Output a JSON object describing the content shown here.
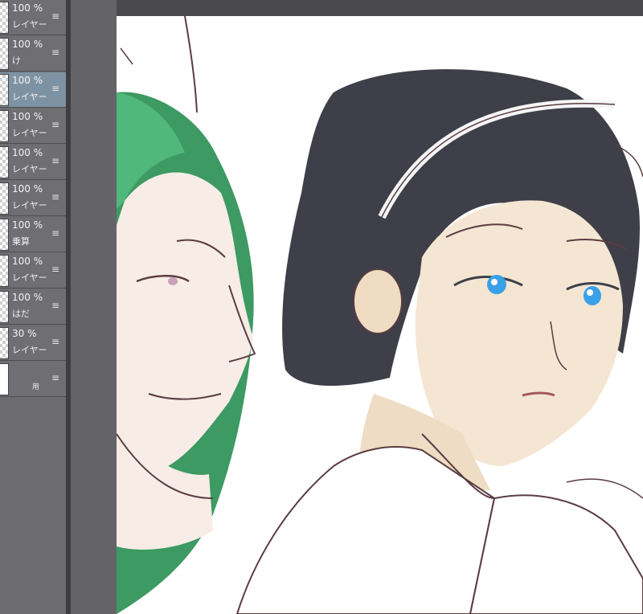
{
  "layers_panel": {
    "layers": [
      {
        "opacity": "100 %",
        "name": "レイヤー"
      },
      {
        "opacity": "100 %",
        "name": "け"
      },
      {
        "opacity": "100 %",
        "name": "レイヤー"
      },
      {
        "opacity": "100 %",
        "name": "レイヤー"
      },
      {
        "opacity": "100 %",
        "name": "レイヤー"
      },
      {
        "opacity": "100 %",
        "name": "レイヤー"
      },
      {
        "opacity": "100 %",
        "name": "乗算"
      },
      {
        "opacity": "100 %",
        "name": "レイヤー"
      },
      {
        "opacity": "100 %",
        "name": "はだ"
      },
      {
        "opacity": "30 %",
        "name": "レイヤー"
      },
      {
        "opacity": "",
        "name": "用"
      }
    ],
    "selected_index": 2,
    "menu_icon": "hamburger-menu-icon"
  },
  "colors": {
    "panel_bg": "#6e6e73",
    "selected_bg": "#7d93a3",
    "canvas_bg": "#ffffff",
    "line_art": "#5a3c42",
    "hair_green": "#3c9a62",
    "hair_dark": "#3e3f48",
    "skin": "#f4e6d2",
    "eyes": "#3aa0e8"
  }
}
